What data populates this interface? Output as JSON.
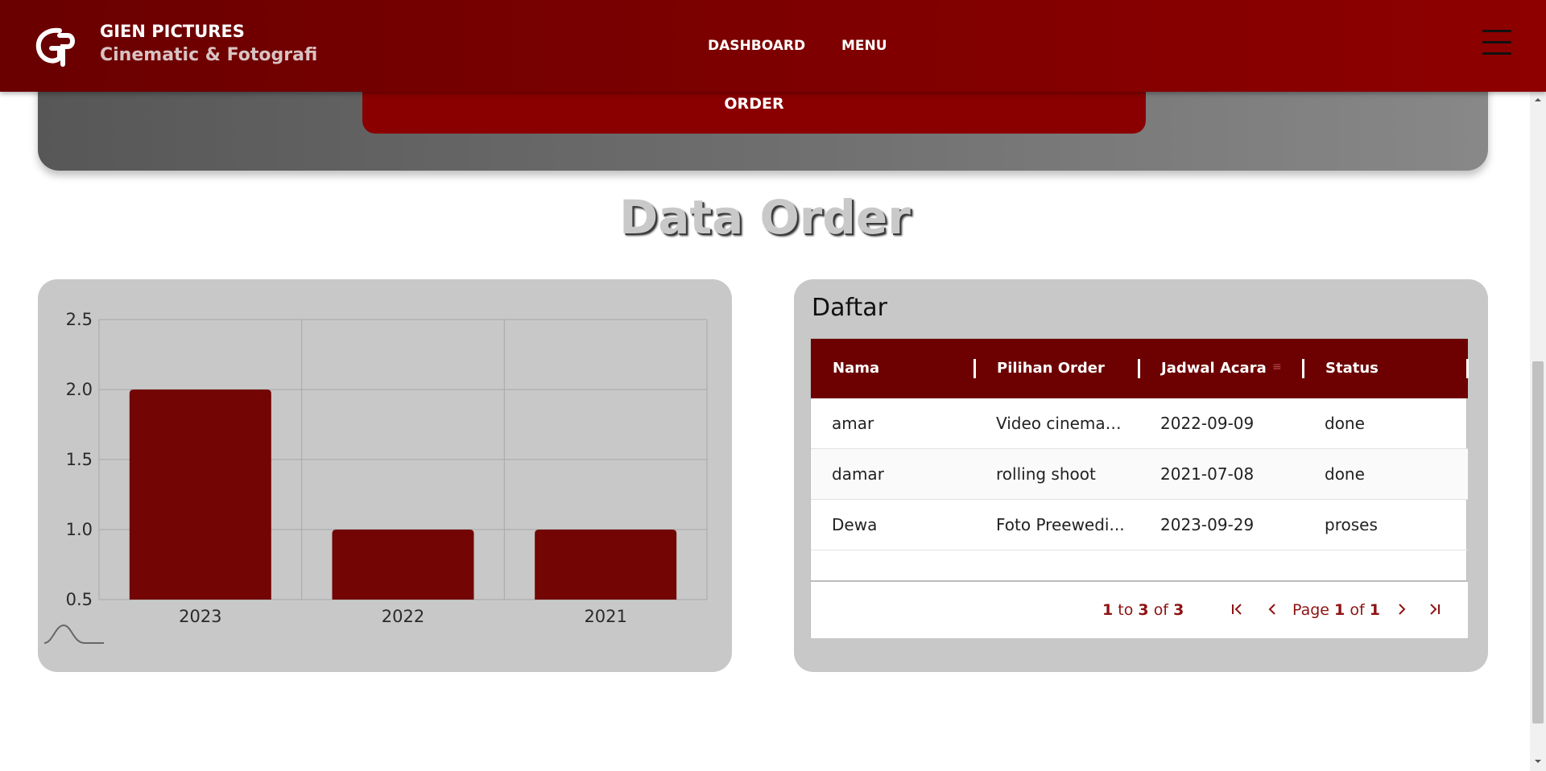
{
  "header": {
    "brand_title": "GIEN PICTURES",
    "brand_subtitle": "Cinematic & Fotografi",
    "nav": [
      "DASHBOARD",
      "MENU"
    ],
    "logo_icon": "gp-logo-icon",
    "menu_icon": "hamburger-menu-icon"
  },
  "hero": {
    "order_label": "ORDER"
  },
  "section": {
    "title": "Data Order"
  },
  "colors": {
    "primary": "#6d0000",
    "header_gradient_end": "#8e0000",
    "card": "#c8c8c8",
    "accent_text": "#8e1212"
  },
  "chart_data": {
    "type": "bar",
    "categories": [
      "2023",
      "2022",
      "2021"
    ],
    "values": [
      2,
      1,
      1
    ],
    "ylim": [
      0.5,
      2.5
    ],
    "yticks": [
      "2.5",
      "2.0",
      "1.5",
      "1.0",
      "0.5"
    ],
    "grid": true,
    "bar_color": "#730505"
  },
  "table": {
    "title": "Daftar",
    "columns": [
      "Nama",
      "Pilihan Order",
      "Jadwal Acara",
      "Status"
    ],
    "sort_icon": "sort-lines-icon",
    "rows": [
      {
        "nama": "amar",
        "pilihan": "Video cinematic",
        "jadwal": "2022-09-09",
        "status": "done"
      },
      {
        "nama": "damar",
        "pilihan": "rolling shoot",
        "jadwal": "2021-07-08",
        "status": "done"
      },
      {
        "nama": "Dewa",
        "pilihan": "Foto Preewedi...",
        "jadwal": "2023-09-29",
        "status": "proses"
      }
    ],
    "pagination": {
      "from": "1",
      "to_word": "to",
      "to": "3",
      "of_word": "of",
      "total": "3",
      "page_word": "Page",
      "page": "1",
      "of_word2": "of",
      "pages": "1"
    }
  }
}
